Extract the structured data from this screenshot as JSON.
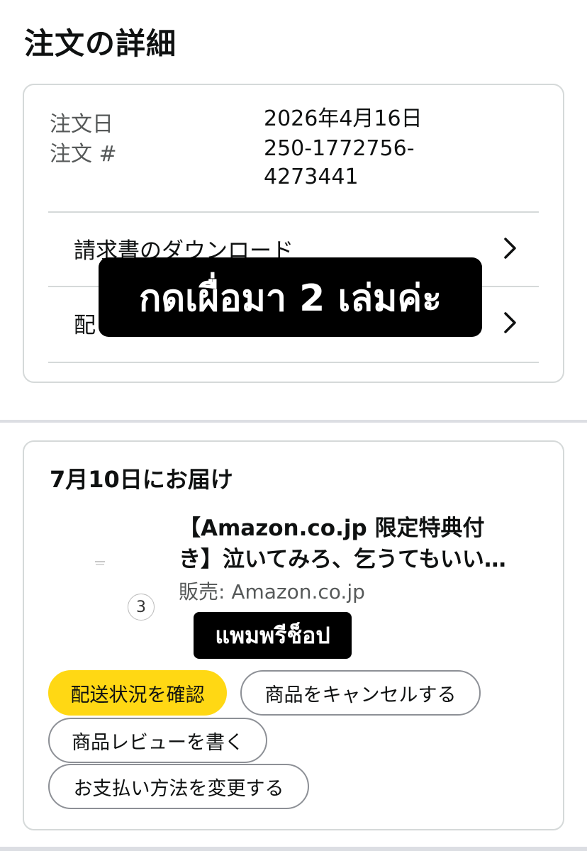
{
  "page": {
    "title": "注文の詳細"
  },
  "order": {
    "date_label": "注文日",
    "date_value": "2026年4月16日",
    "number_label": "注文 #",
    "number_value_line1": "250-1772756-",
    "number_value_line2": "4273441"
  },
  "links": [
    {
      "label": "請求書のダウンロード"
    },
    {
      "label": "配"
    }
  ],
  "delivery": {
    "title": "7月10日にお届け",
    "quantity": "3",
    "product_title_line1": "【Amazon.co.jp 限定特典付",
    "product_title_line2": "き】泣いてみろ、乞うてもいい…",
    "seller": "販売: Amazon.co.jp"
  },
  "buttons": {
    "track": "配送状況を確認",
    "cancel": "商品をキャンセルする",
    "review": "商品レビューを書く",
    "payment": "お支払い方法を変更する"
  },
  "overlays": {
    "big": "กดเผื่อมา 2 เล่มค่ะ",
    "small": "แพมพรีช็อป"
  },
  "colors": {
    "primary_button": "#ffd814",
    "border": "#d5d9d9",
    "overlay_bg": "#000000"
  }
}
